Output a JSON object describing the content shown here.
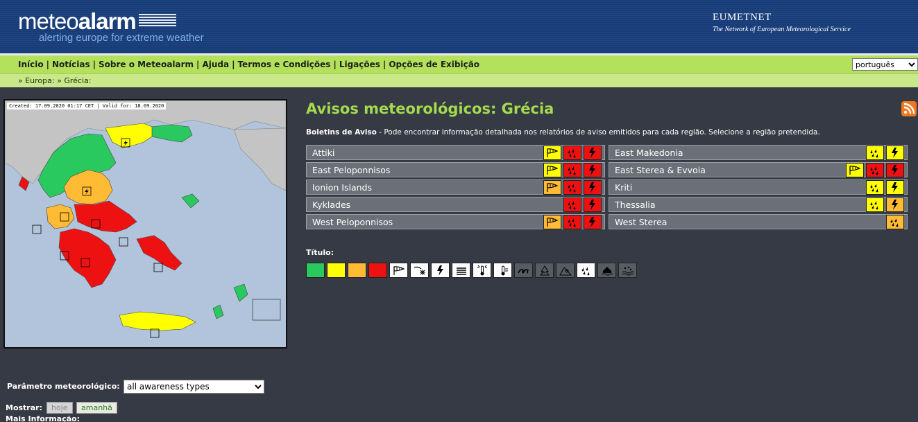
{
  "header": {
    "logo_text_light": "meteo",
    "logo_text_bold": "alarm",
    "logo_tagline": "alerting europe for extreme weather",
    "network_title": "EUMETNET",
    "network_subtitle": "The Network of European Meteorological Service"
  },
  "nav": {
    "items": [
      "Início",
      "Notícias",
      "Sobre o Meteoalarm",
      "Ajuda",
      "Termos e Condições",
      "Ligações",
      "Opções de Exibição"
    ],
    "language": "português"
  },
  "breadcrumb": {
    "items": [
      "Europa:",
      "Grécia:"
    ]
  },
  "map": {
    "created_text": "Created: 17.09.2020 01:17 CET | Valid for: 18.09.2020"
  },
  "main": {
    "title": "Avisos meteorológicos: Grécia",
    "intro_bold": "Boletins de Aviso",
    "intro_text": " - Pode encontrar informação detalhada nos relatórios de aviso emitidos para cada região. Selecione a região pretendida.",
    "regions_left": [
      {
        "name": "Attiki",
        "icons": [
          {
            "type": "wind",
            "color": "yellow"
          },
          {
            "type": "rain",
            "color": "red"
          },
          {
            "type": "thunder",
            "color": "red"
          }
        ]
      },
      {
        "name": "East Peloponnisos",
        "icons": [
          {
            "type": "wind",
            "color": "yellow"
          },
          {
            "type": "rain",
            "color": "red"
          },
          {
            "type": "thunder",
            "color": "red"
          }
        ]
      },
      {
        "name": "Ionion Islands",
        "icons": [
          {
            "type": "wind",
            "color": "orange"
          },
          {
            "type": "rain",
            "color": "red"
          },
          {
            "type": "thunder",
            "color": "red"
          }
        ]
      },
      {
        "name": "Kyklades",
        "icons": [
          {
            "type": "rain",
            "color": "red"
          },
          {
            "type": "thunder",
            "color": "red"
          }
        ]
      },
      {
        "name": "West Peloponnisos",
        "icons": [
          {
            "type": "wind",
            "color": "orange"
          },
          {
            "type": "rain",
            "color": "red"
          },
          {
            "type": "thunder",
            "color": "red"
          }
        ]
      }
    ],
    "regions_right": [
      {
        "name": "East Makedonia",
        "icons": [
          {
            "type": "rain",
            "color": "yellow"
          },
          {
            "type": "thunder",
            "color": "yellow"
          }
        ]
      },
      {
        "name": "East Sterea & Evvoia",
        "icons": [
          {
            "type": "wind",
            "color": "yellow"
          },
          {
            "type": "rain",
            "color": "red"
          },
          {
            "type": "thunder",
            "color": "red"
          }
        ]
      },
      {
        "name": "Kriti",
        "icons": [
          {
            "type": "rain",
            "color": "yellow"
          },
          {
            "type": "thunder",
            "color": "yellow"
          }
        ]
      },
      {
        "name": "Thessalia",
        "icons": [
          {
            "type": "rain",
            "color": "yellow"
          },
          {
            "type": "thunder",
            "color": "orange"
          }
        ]
      },
      {
        "name": "West Sterea",
        "icons": [
          {
            "type": "rain",
            "color": "orange"
          }
        ]
      }
    ],
    "legend_title": "Título:",
    "legend": [
      {
        "type": "blank",
        "color": "green"
      },
      {
        "type": "blank",
        "color": "yellow"
      },
      {
        "type": "blank",
        "color": "orange"
      },
      {
        "type": "blank",
        "color": "red"
      },
      {
        "type": "wind",
        "color": "white"
      },
      {
        "type": "snow",
        "color": "white"
      },
      {
        "type": "thunder",
        "color": "white"
      },
      {
        "type": "fog",
        "color": "white"
      },
      {
        "type": "heat",
        "color": "white"
      },
      {
        "type": "cold",
        "color": "white"
      },
      {
        "type": "coastal",
        "color": "grey"
      },
      {
        "type": "forest",
        "color": "grey"
      },
      {
        "type": "avalanche",
        "color": "grey"
      },
      {
        "type": "rain",
        "color": "white"
      },
      {
        "type": "flood",
        "color": "grey"
      },
      {
        "type": "rainflood",
        "color": "grey"
      }
    ]
  },
  "controls": {
    "param_label": "Parâmetro meteorológico:",
    "param_value": "all awareness types",
    "show_label": "Mostrar:",
    "today_label": "hoje",
    "tomorrow_label": "amanhã",
    "more_label": "Mais Informação:"
  },
  "colors": {
    "yellow": "#ffff00",
    "orange": "#ffbb33",
    "red": "#ee1111",
    "green": "#29c95f",
    "accent_green": "#a5dc4e"
  }
}
